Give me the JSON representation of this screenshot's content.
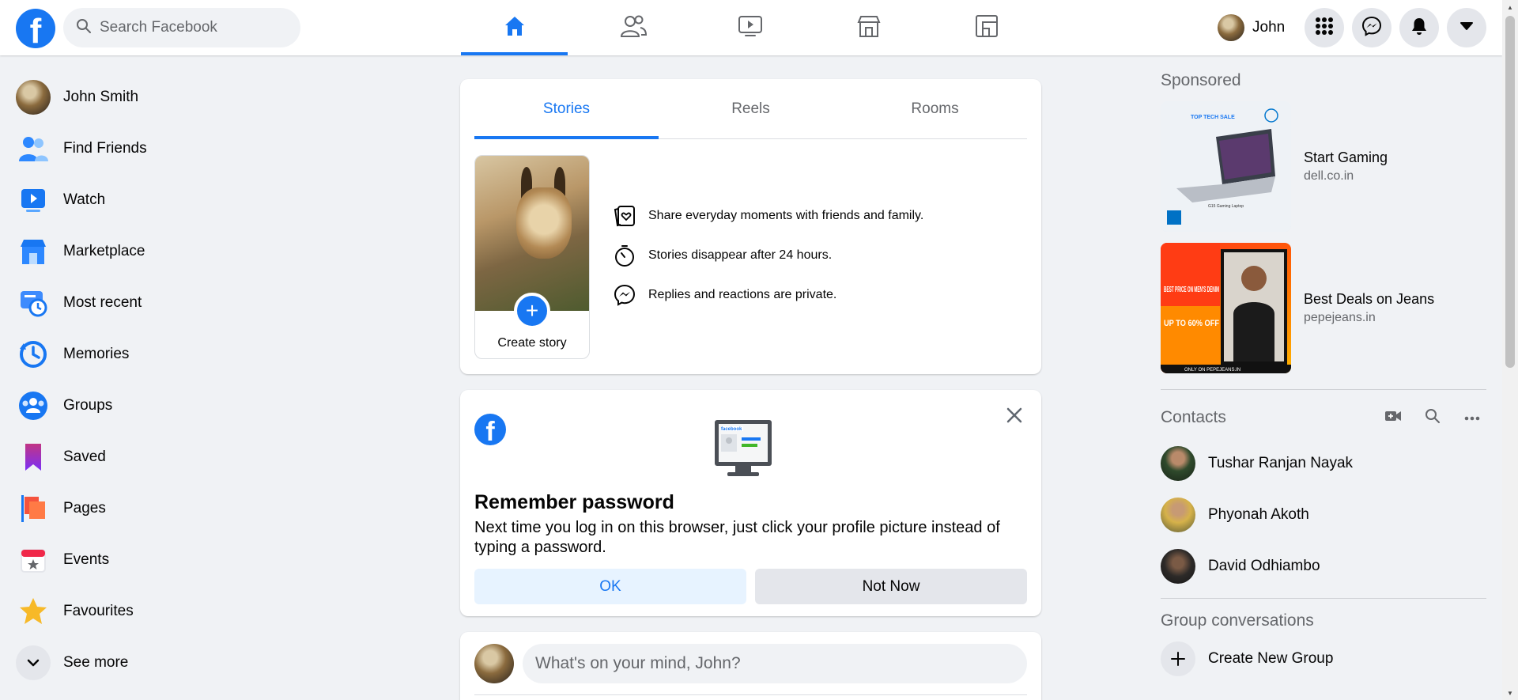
{
  "colors": {
    "brand": "#1877f2",
    "bg": "#f0f2f5",
    "text_secondary": "#65676b"
  },
  "topbar": {
    "logo": "f",
    "search_placeholder": "Search Facebook",
    "tabs": [
      {
        "name": "home",
        "icon": "home-icon",
        "active": true
      },
      {
        "name": "friends",
        "icon": "friends-icon",
        "active": false
      },
      {
        "name": "watch",
        "icon": "watch-video-icon",
        "active": false
      },
      {
        "name": "marketplace",
        "icon": "marketplace-store-icon",
        "active": false
      },
      {
        "name": "gaming",
        "icon": "gaming-icon",
        "active": false
      }
    ],
    "profile_name": "John",
    "buttons": [
      "menu-grid-icon",
      "messenger-icon",
      "notifications-bell-icon",
      "account-caret-icon"
    ]
  },
  "left_nav": {
    "items": [
      {
        "label": "John Smith",
        "icon": "profile-avatar"
      },
      {
        "label": "Find Friends",
        "icon": "find-friends-icon"
      },
      {
        "label": "Watch",
        "icon": "watch-icon"
      },
      {
        "label": "Marketplace",
        "icon": "marketplace-icon"
      },
      {
        "label": "Most recent",
        "icon": "most-recent-icon"
      },
      {
        "label": "Memories",
        "icon": "memories-clock-icon"
      },
      {
        "label": "Groups",
        "icon": "groups-icon"
      },
      {
        "label": "Saved",
        "icon": "saved-bookmark-icon"
      },
      {
        "label": "Pages",
        "icon": "pages-flag-icon"
      },
      {
        "label": "Events",
        "icon": "events-calendar-icon"
      },
      {
        "label": "Favourites",
        "icon": "favourites-star-icon"
      }
    ],
    "see_more": "See more"
  },
  "stories": {
    "tabs": [
      "Stories",
      "Reels",
      "Rooms"
    ],
    "create_label": "Create story",
    "info": [
      "Share everyday moments with friends and family.",
      "Stories disappear after 24 hours.",
      "Replies and reactions are private."
    ]
  },
  "remember_password": {
    "title": "Remember password",
    "text": "Next time you log in on this browser, just click your profile picture instead of typing a password.",
    "ok": "OK",
    "not_now": "Not Now"
  },
  "composer": {
    "placeholder": "What's on your mind, John?"
  },
  "right": {
    "sponsored_title": "Sponsored",
    "ads": [
      {
        "title": "Start Gaming",
        "url": "dell.co.in",
        "banner": [
          "TOP TECH SALE",
          "G15 Gaming Laptop"
        ]
      },
      {
        "title": "Best Deals on Jeans",
        "url": "pepejeans.in",
        "banner": [
          "BEST PRICE ON MEN'S DENIM",
          "UP TO 60% OFF",
          "ONLY ON PEPEJEANS.IN"
        ]
      }
    ],
    "contacts_title": "Contacts",
    "contacts": [
      "Tushar Ranjan Nayak",
      "Phyonah Akoth",
      "David Odhiambo"
    ],
    "group_title": "Group conversations",
    "create_group": "Create New Group"
  }
}
